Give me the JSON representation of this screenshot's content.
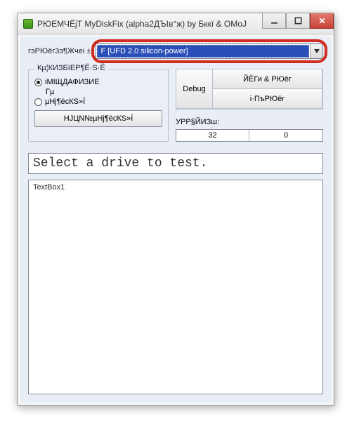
{
  "window": {
    "title": "РЮЕМЧЁјТ MyDiskFix (alpha2ДЪІв°ж) by Бккї & ОМоЈ"
  },
  "drive": {
    "label": "гэРЮёг3э¶Жчеі ±:",
    "selected": "F [UFD 2.0 silicon-power]"
  },
  "mode_group": {
    "title": "Кµ¦КИЗБїЕР¶Ё·S·Ё",
    "option1": "іМІЩДАФИЗИЕ",
    "option1b": "Гµ",
    "option2": "µНј¶ёсКЅ»Ї",
    "run_button": "НЈЦN№µНј¶ёсКЅ»Ї"
  },
  "right": {
    "debug": "Debug",
    "btn1": "ЙЁГи & РЮёг",
    "btn2": "і·ПъРЮёг"
  },
  "stats": {
    "label": "УРР§ЙИЗш:",
    "left": "32",
    "right": "0"
  },
  "status": "Select a drive to test.",
  "textbox": "TextBox1"
}
